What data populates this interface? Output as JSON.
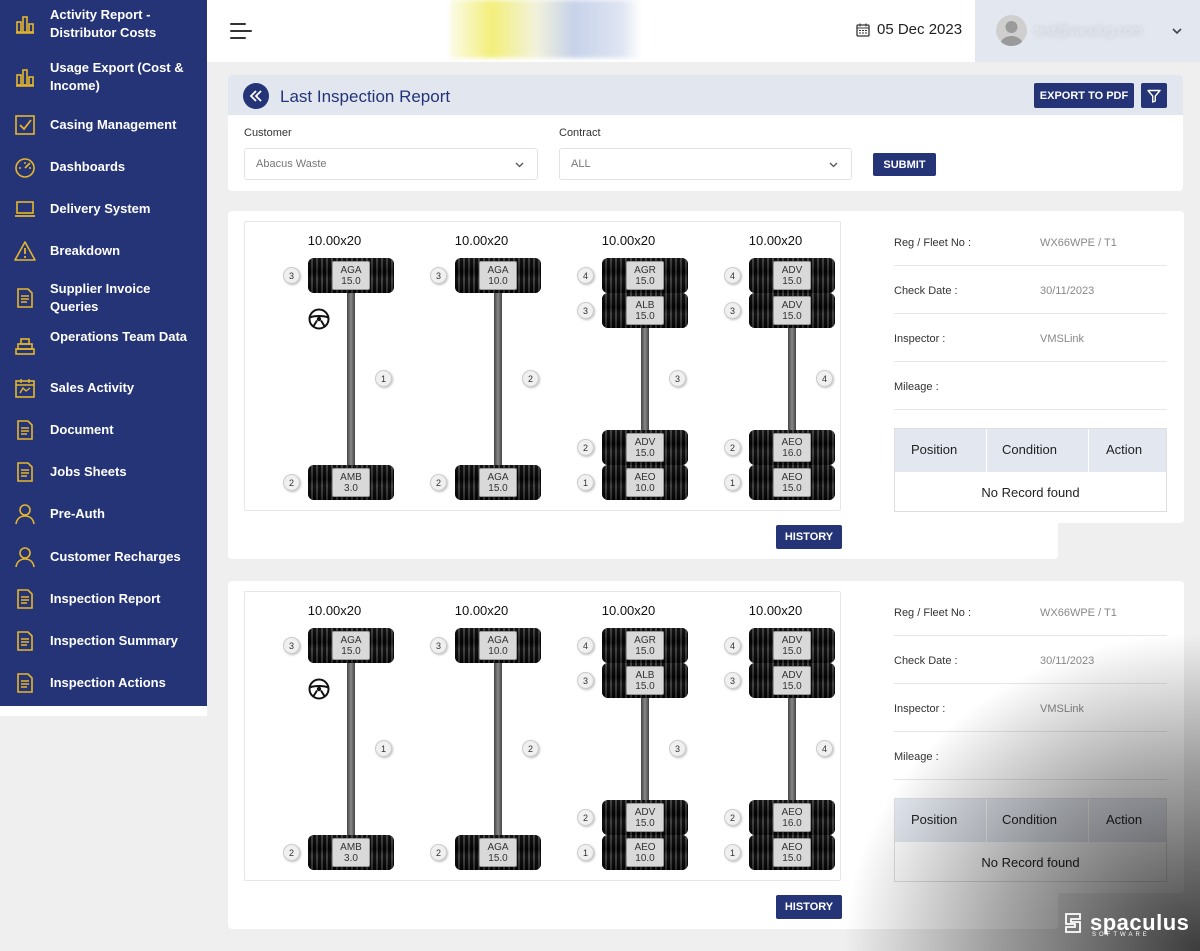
{
  "sidebar": {
    "items": [
      {
        "label": "Activity Report - Distributor Costs",
        "icon": "bar-chart-icon"
      },
      {
        "label": "Usage Export (Cost & Income)",
        "icon": "bar-chart-icon"
      },
      {
        "label": "Casing Management",
        "icon": "checkbox-icon"
      },
      {
        "label": "Dashboards",
        "icon": "gauge-icon"
      },
      {
        "label": "Delivery System",
        "icon": "laptop-icon"
      },
      {
        "label": "Breakdown",
        "icon": "warning-icon"
      },
      {
        "label": "Supplier Invoice Queries",
        "icon": "document-icon"
      },
      {
        "label": "Operations Team Data",
        "icon": "stack-icon"
      },
      {
        "label": "Sales Activity",
        "icon": "calendar-icon"
      },
      {
        "label": "Document",
        "icon": "document-icon"
      },
      {
        "label": "Jobs Sheets",
        "icon": "document-icon"
      },
      {
        "label": "Pre-Auth",
        "icon": "user-icon"
      },
      {
        "label": "Customer Recharges",
        "icon": "user-icon"
      },
      {
        "label": "Inspection Report",
        "icon": "document-icon"
      },
      {
        "label": "Inspection Summary",
        "icon": "document-icon"
      },
      {
        "label": "Inspection Actions",
        "icon": "document-icon"
      }
    ]
  },
  "header": {
    "date": "05 Dec 2023",
    "user_email": "test@vaculug.com"
  },
  "report": {
    "title": "Last Inspection Report",
    "export_label": "EXPORT TO PDF",
    "customer_label": "Customer",
    "customer_value": "Abacus Waste",
    "contract_label": "Contract",
    "contract_value": "ALL",
    "submit_label": "SUBMIT"
  },
  "vehicles": [
    {
      "history_label": "HISTORY",
      "axles": [
        {
          "size": "10.00x20",
          "axle_no": "1",
          "steer": true,
          "top": [
            {
              "code": "AGA",
              "depth": "15.0",
              "pos": "3"
            }
          ],
          "bottom": [
            {
              "code": "AMB",
              "depth": "3.0",
              "pos": "2"
            }
          ]
        },
        {
          "size": "10.00x20",
          "axle_no": "2",
          "steer": false,
          "top": [
            {
              "code": "AGA",
              "depth": "10.0",
              "pos": "3"
            }
          ],
          "bottom": [
            {
              "code": "AGA",
              "depth": "15.0",
              "pos": "2"
            }
          ]
        },
        {
          "size": "10.00x20",
          "axle_no": "3",
          "steer": false,
          "top": [
            {
              "code": "AGR",
              "depth": "15.0",
              "pos": "4"
            },
            {
              "code": "ALB",
              "depth": "15.0",
              "pos": "3"
            }
          ],
          "bottom": [
            {
              "code": "ADV",
              "depth": "15.0",
              "pos": "2"
            },
            {
              "code": "AEO",
              "depth": "10.0",
              "pos": "1"
            }
          ]
        },
        {
          "size": "10.00x20",
          "axle_no": "4",
          "steer": false,
          "top": [
            {
              "code": "ADV",
              "depth": "15.0",
              "pos": "4"
            },
            {
              "code": "ADV",
              "depth": "15.0",
              "pos": "3"
            }
          ],
          "bottom": [
            {
              "code": "AEO",
              "depth": "16.0",
              "pos": "2"
            },
            {
              "code": "AEO",
              "depth": "15.0",
              "pos": "1"
            }
          ]
        }
      ],
      "info": {
        "reg_label": "Reg / Fleet No :",
        "reg_value": "WX66WPE / T1",
        "check_label": "Check Date :",
        "check_value": "30/11/2023",
        "inspector_label": "Inspector :",
        "inspector_value": "VMSLink",
        "mileage_label": "Mileage :",
        "mileage_value": ""
      },
      "table": {
        "headers": [
          "Position",
          "Condition",
          "Action"
        ],
        "empty": "No Record found"
      }
    },
    {
      "history_label": "HISTORY",
      "axles": [
        {
          "size": "10.00x20",
          "axle_no": "1",
          "steer": true,
          "top": [
            {
              "code": "AGA",
              "depth": "15.0",
              "pos": "3"
            }
          ],
          "bottom": [
            {
              "code": "AMB",
              "depth": "3.0",
              "pos": "2"
            }
          ]
        },
        {
          "size": "10.00x20",
          "axle_no": "2",
          "steer": false,
          "top": [
            {
              "code": "AGA",
              "depth": "10.0",
              "pos": "3"
            }
          ],
          "bottom": [
            {
              "code": "AGA",
              "depth": "15.0",
              "pos": "2"
            }
          ]
        },
        {
          "size": "10.00x20",
          "axle_no": "3",
          "steer": false,
          "top": [
            {
              "code": "AGR",
              "depth": "15.0",
              "pos": "4"
            },
            {
              "code": "ALB",
              "depth": "15.0",
              "pos": "3"
            }
          ],
          "bottom": [
            {
              "code": "ADV",
              "depth": "15.0",
              "pos": "2"
            },
            {
              "code": "AEO",
              "depth": "10.0",
              "pos": "1"
            }
          ]
        },
        {
          "size": "10.00x20",
          "axle_no": "4",
          "steer": false,
          "top": [
            {
              "code": "ADV",
              "depth": "15.0",
              "pos": "4"
            },
            {
              "code": "ADV",
              "depth": "15.0",
              "pos": "3"
            }
          ],
          "bottom": [
            {
              "code": "AEO",
              "depth": "16.0",
              "pos": "2"
            },
            {
              "code": "AEO",
              "depth": "15.0",
              "pos": "1"
            }
          ]
        }
      ],
      "info": {
        "reg_label": "Reg / Fleet No :",
        "reg_value": "WX66WPE / T1",
        "check_label": "Check Date :",
        "check_value": "30/11/2023",
        "inspector_label": "Inspector :",
        "inspector_value": "VMSLink",
        "mileage_label": "Mileage :",
        "mileage_value": ""
      },
      "table": {
        "headers": [
          "Position",
          "Condition",
          "Action"
        ],
        "empty": "No Record found"
      }
    }
  ],
  "watermark": {
    "name": "spaculus",
    "sub": "SOFTWARE"
  },
  "colors": {
    "primary": "#243477",
    "accent": "#e5b62b",
    "panel_header": "#e2e6ef"
  }
}
